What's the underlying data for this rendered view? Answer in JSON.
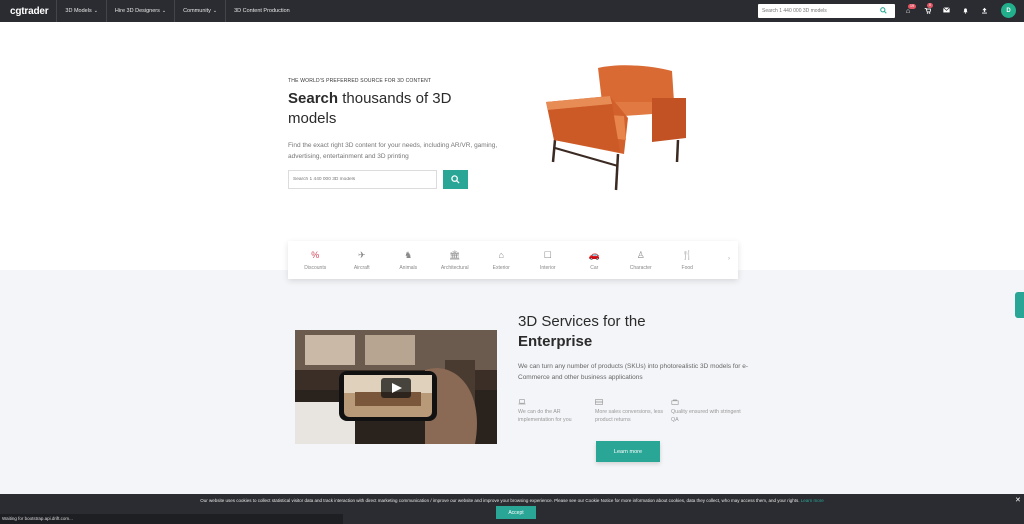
{
  "nav": {
    "logo": "cgtrader",
    "items": [
      {
        "label": "3D Models",
        "chevron": "⌄"
      },
      {
        "label": "Hire 3D Designers",
        "chevron": "⌄"
      },
      {
        "label": "Community",
        "chevron": "⌄"
      },
      {
        "label": "3D Content Production",
        "chevron": ""
      }
    ],
    "search_placeholder": "Search 1 440 000 3D models",
    "notification_badges": {
      "home": "19",
      "cart": "0"
    },
    "avatar_initial": "D"
  },
  "hero": {
    "kicker": "THE WORLD'S PREFERRED SOURCE FOR 3D CONTENT",
    "title_bold": "Search",
    "title_rest": " thousands of 3D models",
    "description": "Find the exact right 3D content for your needs, including AR/VR, gaming, advertising, entertainment and 3D printing",
    "search_placeholder": "Search 1 440 000 3D models"
  },
  "categories": [
    {
      "label": "Discounts",
      "icon": "%"
    },
    {
      "label": "Aircraft",
      "icon": "✈"
    },
    {
      "label": "Animals",
      "icon": "♞"
    },
    {
      "label": "Architectural",
      "icon": "🏛"
    },
    {
      "label": "Exterior",
      "icon": "⌂"
    },
    {
      "label": "Interior",
      "icon": "☐"
    },
    {
      "label": "Car",
      "icon": "🚗"
    },
    {
      "label": "Character",
      "icon": "♙"
    },
    {
      "label": "Food",
      "icon": "🍴"
    }
  ],
  "enterprise": {
    "title_line1": "3D Services for the",
    "title_bold": "Enterprise",
    "description": "We can turn any number of products (SKUs) into photorealistic 3D models for e-Commerce and other business applications",
    "features": [
      {
        "text": "We can do the AR implementation for you"
      },
      {
        "text": "More sales conversions, less product returns"
      },
      {
        "text": "Quality ensured with stringent QA"
      }
    ],
    "cta_label": "Learn more"
  },
  "cookie": {
    "text": "Our website uses cookies to collect statistical visitor data and track interaction with direct marketing communication / improve our website and improve your browsing experience. Please see our Cookie Notice for more information about cookies, data they collect, who may access them, and your rights.",
    "link": "Learn more",
    "accept_label": "Accept",
    "close": "✕"
  },
  "status_bar": "Waiting for bootstrap.api.drift.com..."
}
